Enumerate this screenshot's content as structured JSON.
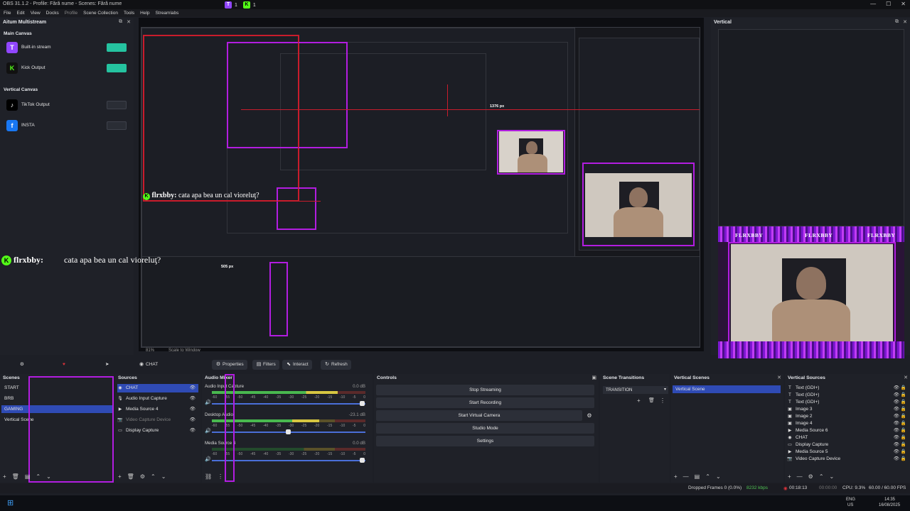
{
  "window": {
    "title": "OBS 31.1.2 - Profile: Fără nume - Scenes: Fără nume",
    "badges": [
      {
        "icon": "twitch-icon",
        "count": "1"
      },
      {
        "icon": "kick-icon",
        "count": "1"
      }
    ],
    "controls": [
      "—",
      "☐",
      "✕"
    ]
  },
  "menu": [
    "File",
    "Edit",
    "View",
    "Docks",
    "Profile",
    "Scene Collection",
    "Tools",
    "Help",
    "Streamlabs"
  ],
  "multistream": {
    "title": "Aitum Multistream",
    "main_canvas_label": "Main Canvas",
    "vertical_canvas_label": "Vertical Canvas",
    "main_outputs": [
      {
        "label": "Built-in stream",
        "icon": "twitch-icon",
        "active": true
      },
      {
        "label": "Kick Output",
        "icon": "kick-icon",
        "active": true
      }
    ],
    "vertical_outputs": [
      {
        "label": "TikTok Output",
        "icon": "tiktok-icon",
        "active": false
      },
      {
        "label": "INSTA",
        "icon": "facebook-icon",
        "active": false
      }
    ]
  },
  "preview": {
    "chat_user": "flrxbby:",
    "chat_message": "cata apa bea un cal vioreluţ?",
    "measure_1": "1376 px",
    "measure_2": "505 px",
    "zoom": "81%",
    "scale_mode": "Scale to Window"
  },
  "vertical_preview": {
    "title": "Vertical",
    "brand": "FLRXBBY"
  },
  "toolbar": {
    "active_source": "CHAT",
    "properties": "Properties",
    "filters": "Filters",
    "interact": "Interact",
    "refresh": "Refresh"
  },
  "scenes": {
    "title": "Scenes",
    "items": [
      "START",
      "BRB",
      "GAMING",
      "Vertical Scene"
    ],
    "selected": "GAMING"
  },
  "sources": {
    "title": "Sources",
    "items": [
      {
        "label": "CHAT",
        "icon": "browser-icon",
        "dim": false,
        "selected": true
      },
      {
        "label": "Audio Input Capture",
        "icon": "microphone-icon",
        "dim": false,
        "selected": false
      },
      {
        "label": "Media Source 4",
        "icon": "play-icon",
        "dim": false,
        "selected": false
      },
      {
        "label": "Video Capture Device",
        "icon": "camera-icon",
        "dim": true,
        "selected": false
      },
      {
        "label": "Display Capture",
        "icon": "monitor-icon",
        "dim": false,
        "selected": false
      }
    ]
  },
  "mixer": {
    "title": "Audio Mixer",
    "ticks": [
      "-60",
      "-55",
      "-50",
      "-45",
      "-40",
      "-35",
      "-30",
      "-25",
      "-20",
      "-15",
      "-10",
      "-5",
      "0"
    ],
    "channels": [
      {
        "name": "Audio Input Capture",
        "db": "0.0 dB",
        "level": 0.82,
        "fader": 0.98
      },
      {
        "name": "Desktop Audio",
        "db": "-23.1 dB",
        "level": 0.7,
        "fader": 0.5
      },
      {
        "name": "Media Source 4",
        "db": "0.0 dB",
        "level": 0.0,
        "fader": 0.98
      }
    ]
  },
  "controls": {
    "title": "Controls",
    "buttons": [
      "Stop Streaming",
      "Start Recording",
      "Start Virtual Camera",
      "Studio Mode",
      "Settings"
    ]
  },
  "transitions": {
    "title": "Scene Transitions",
    "selected": "TRANSITION"
  },
  "vertical_scenes": {
    "title": "Vertical Scenes",
    "items": [
      "Vertical Scene"
    ]
  },
  "vertical_sources": {
    "title": "Vertical Sources",
    "items": [
      {
        "label": "Text (GDI+)",
        "icon": "text-icon"
      },
      {
        "label": "Text (GDI+)",
        "icon": "text-icon"
      },
      {
        "label": "Text (GDI+)",
        "icon": "text-icon"
      },
      {
        "label": "Image 3",
        "icon": "image-icon"
      },
      {
        "label": "Image 2",
        "icon": "image-icon"
      },
      {
        "label": "Image 4",
        "icon": "image-icon"
      },
      {
        "label": "Media Source 6",
        "icon": "play-icon"
      },
      {
        "label": "CHAT",
        "icon": "browser-icon"
      },
      {
        "label": "Display Capture",
        "icon": "monitor-icon"
      },
      {
        "label": "Media Source 5",
        "icon": "play-icon"
      },
      {
        "label": "Video Capture Device",
        "icon": "camera-icon"
      }
    ]
  },
  "status": {
    "dropped": "Dropped Frames 0 (0.0%)",
    "bitrate": "8232 kbps",
    "stream_time": "00:18:13",
    "rec_time": "00:00:00",
    "cpu": "CPU: 9.3%",
    "fps": "60.00 / 60.00 FPS"
  },
  "taskbar": {
    "lang_1": "ENG",
    "lang_2": "US",
    "time": "14:35",
    "date": "16/08/2025"
  },
  "colors": {
    "accent": "#2f4bb5",
    "twitch": "#9146ff",
    "kick": "#53fc18",
    "toggle_on": "#25c3a0",
    "magenta": "#b21de0",
    "red": "#c91c2c"
  }
}
